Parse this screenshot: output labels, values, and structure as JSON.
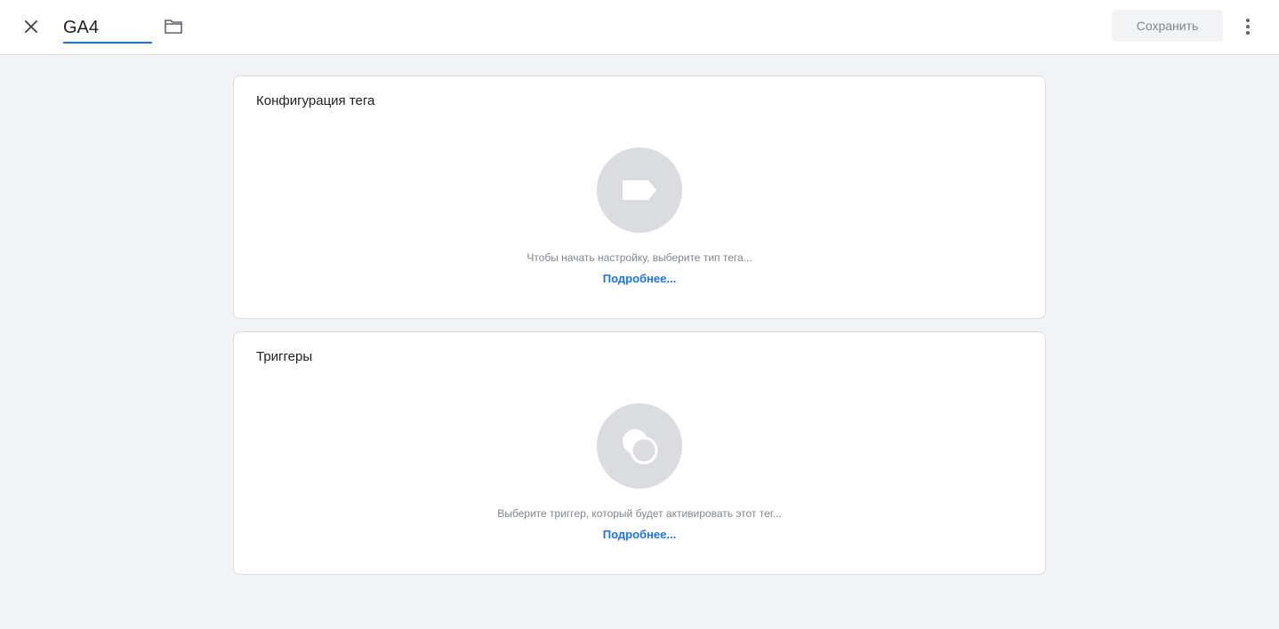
{
  "header": {
    "tag_name": "GA4",
    "save_label": "Сохранить"
  },
  "tag_config": {
    "title": "Конфигурация тега",
    "hint": "Чтобы начать настройку, выберите тип тега...",
    "link": "Подробнее..."
  },
  "triggers": {
    "title": "Триггеры",
    "hint": "Выберите триггер, который будет активировать этот тег...",
    "link": "Подробнее..."
  },
  "colors": {
    "accent": "#1a73e8",
    "background": "#f1f3f4",
    "placeholder_circle": "#dadce0"
  }
}
